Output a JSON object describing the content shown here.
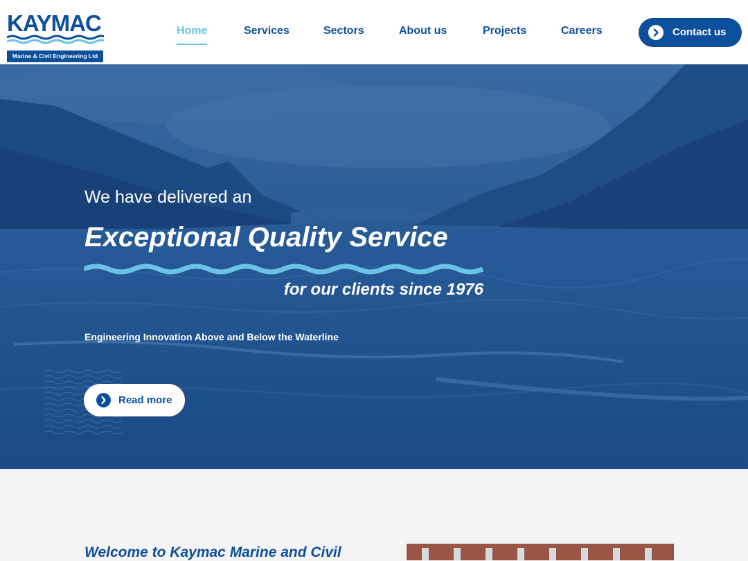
{
  "brand": {
    "name": "KAYMAC",
    "subtitle": "Marine & Civil Engineering Ltd"
  },
  "nav": {
    "items": [
      {
        "label": "Home",
        "active": true
      },
      {
        "label": "Services",
        "active": false
      },
      {
        "label": "Sectors",
        "active": false
      },
      {
        "label": "About us",
        "active": false
      },
      {
        "label": "Projects",
        "active": false
      },
      {
        "label": "Careers",
        "active": false
      }
    ],
    "contact_label": "Contact us"
  },
  "hero": {
    "line1": "We have delivered an",
    "title": "Exceptional Quality Service",
    "since": "for our clients since 1976",
    "tagline": "Engineering Innovation Above and Below the Waterline",
    "cta_label": "Read more"
  },
  "intro": {
    "heading": "Welcome to Kaymac Marine and Civil"
  },
  "colors": {
    "brand_blue": "#0d4f9c",
    "accent_light_blue": "#6cc1e6",
    "hero_overlay": "#1d4d88"
  },
  "icons": {
    "contact": "chevron-right-icon",
    "read_more": "chevron-right-icon"
  }
}
